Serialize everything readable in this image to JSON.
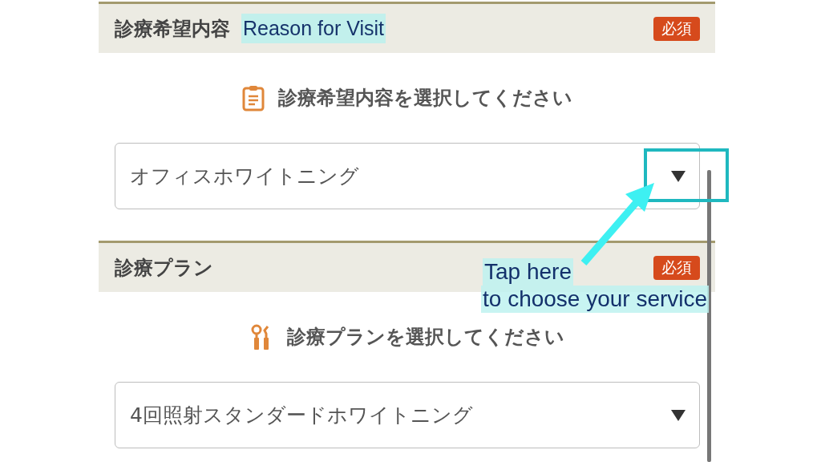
{
  "sections": [
    {
      "title": "診療希望内容",
      "note": "Reason for Visit",
      "badge": "必須",
      "kind": "clipboard",
      "prompt": "診療希望内容を選択してください",
      "value": "オフィスホワイトニング"
    },
    {
      "title": "診療プラン",
      "badge": "必須",
      "kind": "tools",
      "prompt": "診療プランを選択してください",
      "value": "4回照射スタンダードホワイトニング"
    }
  ],
  "annotation": {
    "lines": [
      "Tap here",
      "to choose your service"
    ]
  }
}
